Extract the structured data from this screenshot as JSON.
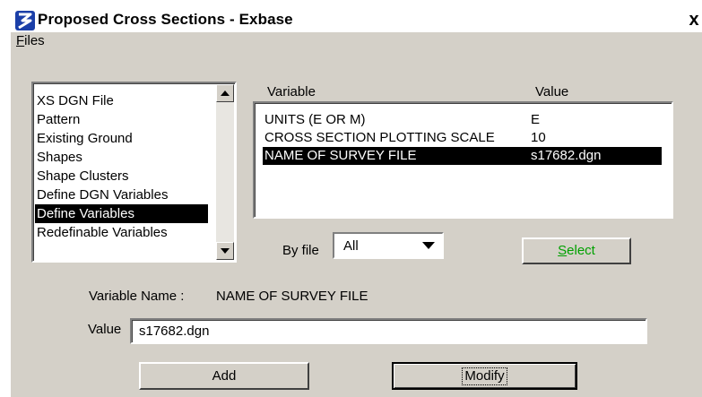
{
  "window": {
    "title": "Proposed Cross Sections - Exbase",
    "close_label": "x",
    "icon": "exbase-logo-icon",
    "accent_color": "#1b3fa8"
  },
  "menu": {
    "files_mnemonic": "F",
    "files_rest": "iles"
  },
  "categories": {
    "items": [
      "XS DGN File",
      "Pattern",
      "Existing Ground",
      "Shapes",
      "Shape Clusters",
      "Define DGN Variables",
      "Define Variables",
      "Redefinable Variables"
    ],
    "selected": "Define Variables"
  },
  "variables": {
    "header_variable": "Variable",
    "header_value": "Value",
    "rows": [
      {
        "name": "UNITS (E OR M)",
        "value": "E"
      },
      {
        "name": "CROSS SECTION PLOTTING SCALE",
        "value": "10"
      },
      {
        "name": "NAME OF SURVEY FILE",
        "value": "s17682.dgn"
      }
    ],
    "selected": "NAME OF SURVEY FILE"
  },
  "filter": {
    "label": "By file",
    "value": "All"
  },
  "select_button": {
    "mnemonic": "S",
    "rest": "elect",
    "color": "#00a000"
  },
  "detail": {
    "name_label": "Variable Name :",
    "name_value": "NAME OF SURVEY FILE",
    "value_label": "Value",
    "value_input": "s17682.dgn"
  },
  "actions": {
    "add_label": "Add",
    "modify_label": "Modify"
  }
}
